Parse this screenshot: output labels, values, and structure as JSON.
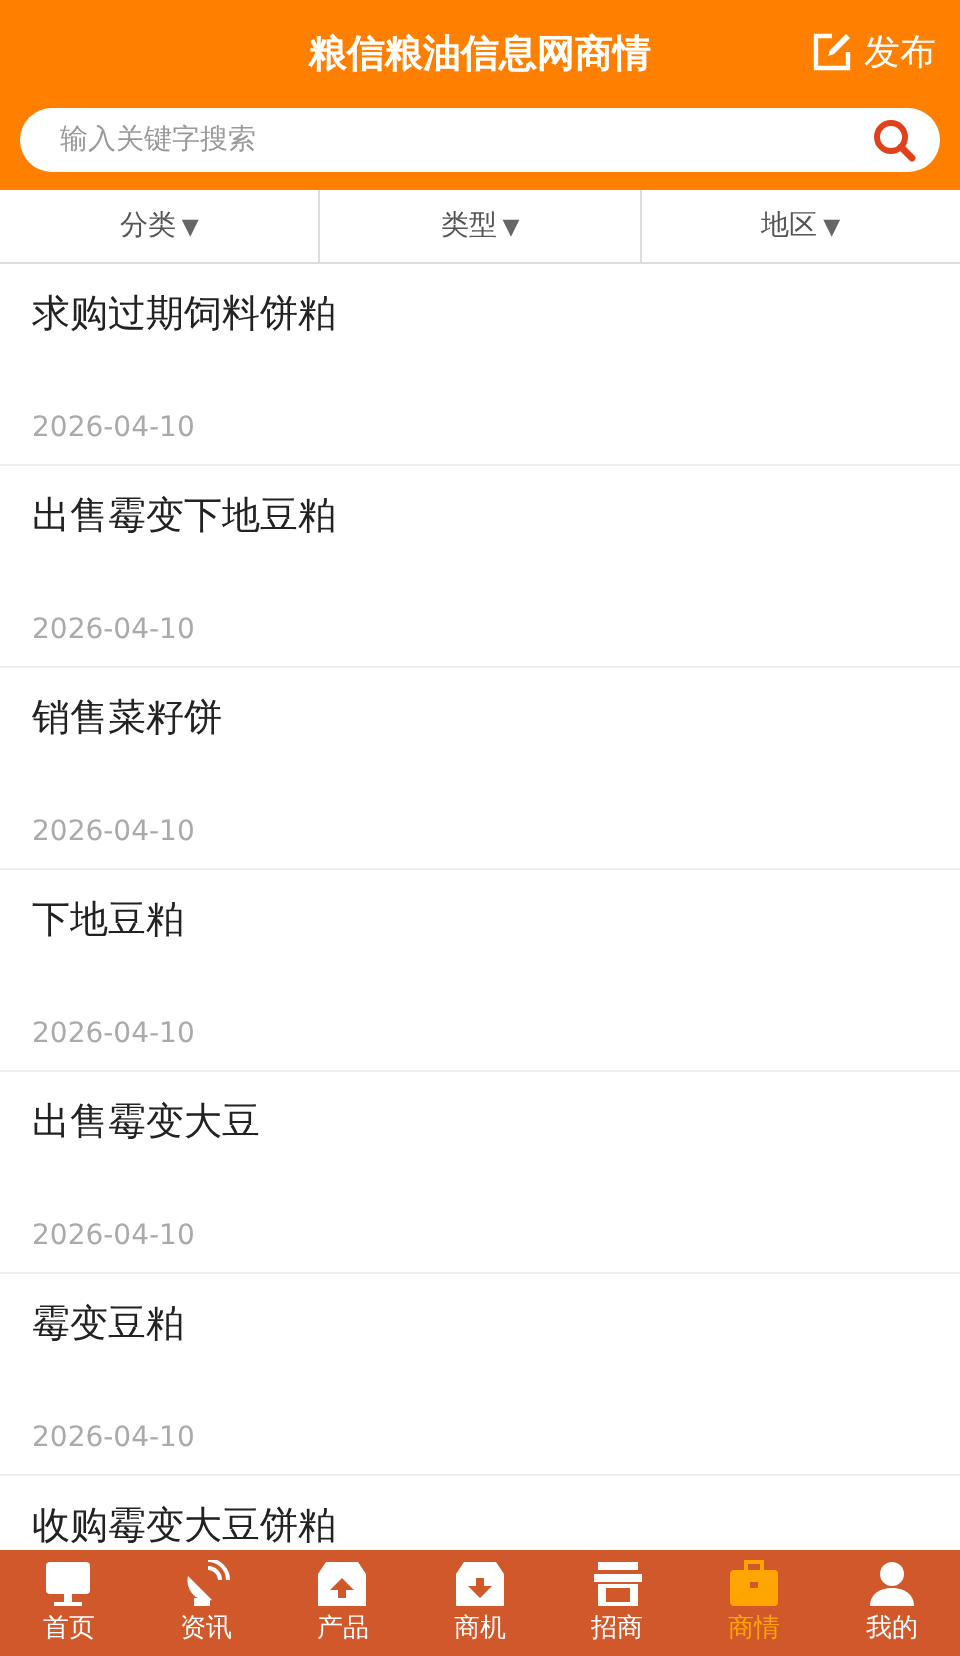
{
  "header": {
    "title": "粮信粮油信息网商情",
    "publish": "发布"
  },
  "search": {
    "placeholder": "输入关键字搜索"
  },
  "filters": [
    {
      "label": "分类",
      "arrow": "▼"
    },
    {
      "label": "类型",
      "arrow": "▼"
    },
    {
      "label": "地区",
      "arrow": "▼"
    }
  ],
  "items": [
    {
      "title": "求购过期饲料饼粕",
      "date": "2026-04-10"
    },
    {
      "title": "出售霉变下地豆粕",
      "date": "2026-04-10"
    },
    {
      "title": "销售菜籽饼",
      "date": "2026-04-10"
    },
    {
      "title": "下地豆粕",
      "date": "2026-04-10"
    },
    {
      "title": "出售霉变大豆",
      "date": "2026-04-10"
    },
    {
      "title": "霉变豆粕",
      "date": "2026-04-10"
    },
    {
      "title": "收购霉变大豆饼粕"
    }
  ],
  "tabs": [
    {
      "kind": "monitor",
      "label": "首页",
      "selected": false
    },
    {
      "kind": "dish",
      "label": "资讯",
      "selected": false
    },
    {
      "kind": "boxup",
      "label": "产品",
      "selected": false
    },
    {
      "kind": "boxdown",
      "label": "商机",
      "selected": false
    },
    {
      "kind": "shop",
      "label": "招商",
      "selected": false
    },
    {
      "kind": "case",
      "label": "商情",
      "selected": true
    },
    {
      "kind": "user",
      "label": "我的",
      "selected": false
    }
  ]
}
